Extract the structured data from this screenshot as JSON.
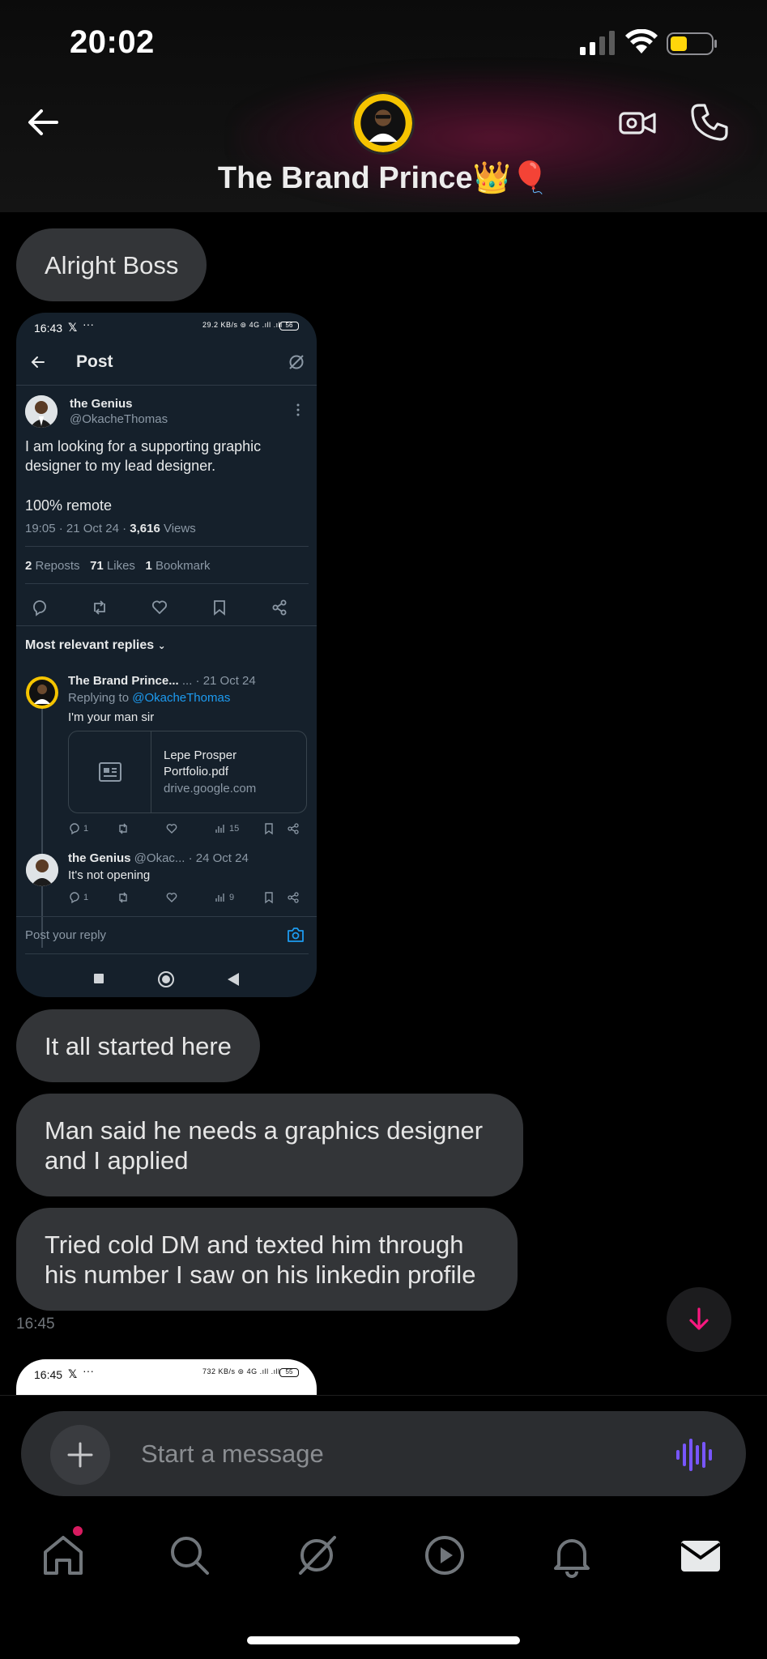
{
  "status_bar": {
    "time": "20:02"
  },
  "header": {
    "contact_name": "The Brand Prince👑🎈"
  },
  "messages": [
    {
      "text": "Alright Boss"
    },
    {
      "text": "It all started here"
    },
    {
      "text": "Man said he needs a graphics designer and I applied"
    },
    {
      "text": "Tried cold DM and texted him through his number I saw on his linkedin profile"
    }
  ],
  "timestamp": "16:45",
  "screenshot": {
    "status_time": "16:43",
    "status_x": "𝕏",
    "status_dots": "···",
    "status_indicators": "29.2 KB/s  ⊚  4G .ıll .ıll",
    "battery": "56",
    "nav_title": "Post",
    "post": {
      "author_name": "the Genius",
      "author_handle": "@OkacheThomas",
      "text": "I am looking for a supporting graphic designer to my lead designer.",
      "text2": "100% remote",
      "meta_time": "19:05 · 21 Oct 24 · ",
      "views_count": "3,616",
      "views_label": " Views",
      "reposts_count": "2",
      "reposts_label": " Reposts",
      "likes_count": "71",
      "likes_label": " Likes",
      "bookmarks_count": "1",
      "bookmarks_label": " Bookmark"
    },
    "replies_header": "Most relevant replies",
    "reply1": {
      "name": "The Brand Prince...",
      "tail": " ... · 21 Oct 24",
      "replying_prefix": "Replying to ",
      "replying_handle": "@OkacheThomas",
      "text": "I'm your man sir",
      "card_title": "Lepe Prosper Portfolio.pdf",
      "card_domain": "drive.google.com",
      "comments": "1",
      "views": "15"
    },
    "reply2": {
      "name": "the Genius",
      "tail": " @Okac... · 24 Oct 24",
      "text": "It's not opening",
      "comments": "1",
      "views": "9"
    },
    "reply_placeholder": "Post your reply"
  },
  "screenshot2": {
    "status_time": "16:45",
    "status_x": "𝕏",
    "status_dots": "···",
    "status_indicators": "732 KB/s  ⊚  4G .ıll .ıll",
    "battery": "55"
  },
  "composer": {
    "placeholder": "Start a message"
  },
  "colors": {
    "accent_pink": "#d81b60",
    "voice_purple": "#7856ff",
    "bubble": "#333538",
    "x_link_blue": "#1d9bf0"
  },
  "icons": {
    "nav": [
      "home-icon",
      "search-icon",
      "grok-icon",
      "video-icon",
      "notifications-icon",
      "messages-icon"
    ]
  }
}
